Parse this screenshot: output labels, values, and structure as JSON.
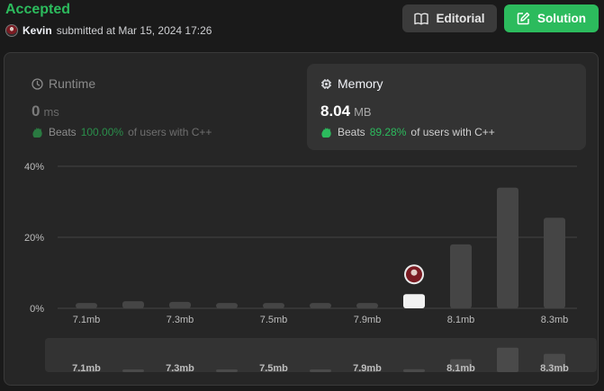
{
  "submission": {
    "status": "Accepted",
    "user": "Kevin",
    "submitted_text": "submitted at Mar 15, 2024 17:26"
  },
  "buttons": {
    "editorial": "Editorial",
    "solution": "Solution"
  },
  "runtime": {
    "title": "Runtime",
    "value": "0",
    "unit": "ms",
    "beats_label": "Beats",
    "beats_pct": "100.00%",
    "beats_suffix": "of users with C++",
    "icon": "clock-icon",
    "selected": false
  },
  "memory": {
    "title": "Memory",
    "value": "8.04",
    "unit": "MB",
    "beats_label": "Beats",
    "beats_pct": "89.28%",
    "beats_suffix": "of users with C++",
    "icon": "chip-icon",
    "selected": true
  },
  "colors": {
    "accent": "#2cbb5d",
    "bar": "#454545",
    "highlight_bar": "#f2f2f2"
  },
  "chart_data": {
    "type": "bar",
    "ylabels": [
      "40%",
      "20%",
      "0%"
    ],
    "ylim": [
      0,
      40
    ],
    "xtick_labels": [
      "7.1mb",
      "7.3mb",
      "7.5mb",
      "7.9mb",
      "8.1mb",
      "8.3mb"
    ],
    "values": [
      1.5,
      2,
      1.8,
      1.5,
      1.5,
      1.5,
      1.5,
      4,
      18,
      34,
      25.5
    ],
    "highlight_index": 7,
    "grid": true
  }
}
